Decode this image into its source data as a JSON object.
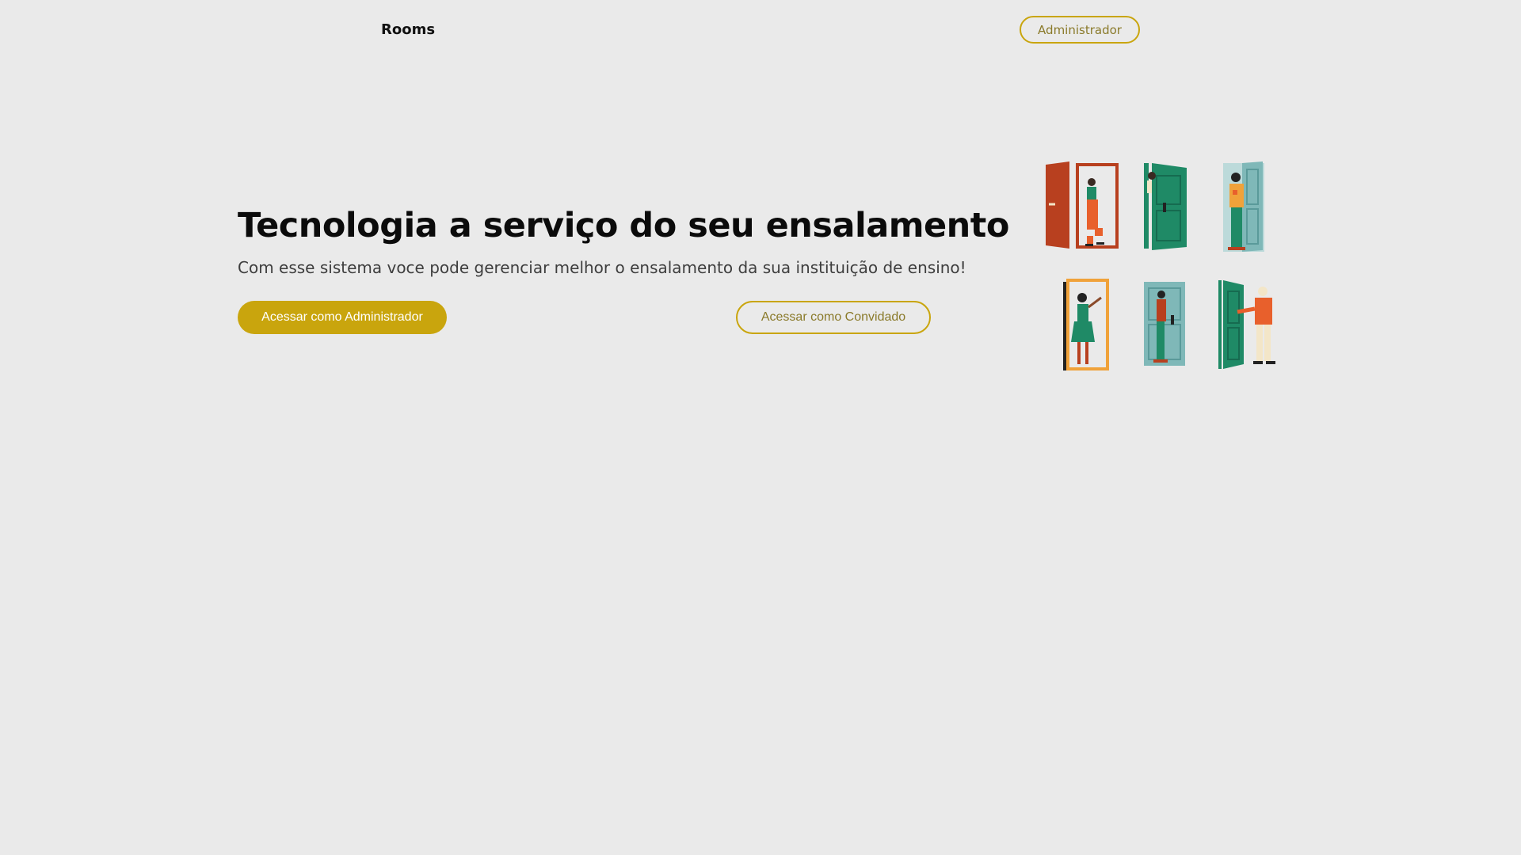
{
  "header": {
    "brand": "Rooms",
    "admin_button_label": "Administrador"
  },
  "hero": {
    "title": "Tecnologia a serviço do seu ensalamento",
    "subtitle": "Com esse sistema voce pode gerenciar melhor o ensalamento da sua instituição de ensino!",
    "primary_button_label": "Acessar como Administrador",
    "secondary_button_label": "Acessar como Convidado"
  },
  "illustration": {
    "icon": "people-at-doors-illustration",
    "colors": {
      "accent": "#c9a50d",
      "door_red": "#b8401f",
      "door_green": "#1f8a66",
      "door_teal": "#7fb8b8",
      "door_orange": "#f0a23a",
      "shirt_orange": "#e8602c"
    }
  },
  "theme": {
    "background": "#eaeaea",
    "accent": "#c9a50d"
  }
}
